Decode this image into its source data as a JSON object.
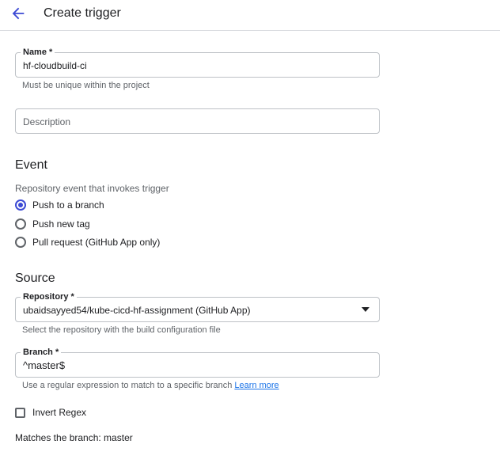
{
  "header": {
    "title": "Create trigger",
    "back_icon": "arrow-back-icon"
  },
  "name_field": {
    "label": "Name *",
    "value": "hf-cloudbuild-ci",
    "hint": "Must be unique within the project"
  },
  "description_field": {
    "placeholder": "Description"
  },
  "event": {
    "title": "Event",
    "subtitle": "Repository event that invokes trigger",
    "options": [
      {
        "label": "Push to a branch",
        "checked": true
      },
      {
        "label": "Push new tag",
        "checked": false
      },
      {
        "label": "Pull request (GitHub App only)",
        "checked": false
      }
    ]
  },
  "source": {
    "title": "Source",
    "repository": {
      "label": "Repository *",
      "value": "ubaidsayyed54/kube-cicd-hf-assignment (GitHub App)",
      "hint": "Select the repository with the build configuration file"
    },
    "branch": {
      "label": "Branch *",
      "value": "^master$",
      "hint": "Use a regular expression to match to a specific branch",
      "link": "Learn more"
    },
    "invert_regex": {
      "label": "Invert Regex",
      "checked": false
    },
    "match_text": "Matches the branch: master"
  },
  "colors": {
    "accent": "#3c4ad4",
    "link": "#1a73e8",
    "border": "#bdc1c6"
  }
}
